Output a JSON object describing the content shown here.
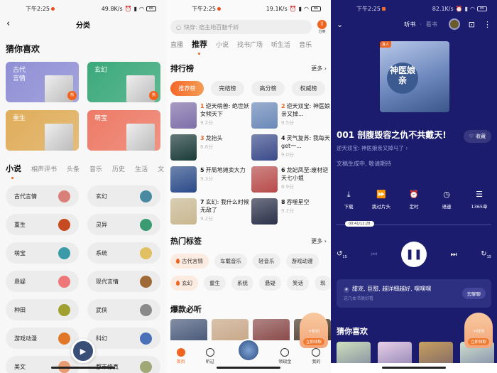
{
  "status_bars": [
    {
      "time": "下午2:25",
      "speed": "49.8K/s",
      "battery": "86"
    },
    {
      "time": "下午2:25",
      "speed": "19.1K/s",
      "battery": "86"
    },
    {
      "time": "下午2:25",
      "speed": "82.1K/s",
      "battery": "86"
    }
  ],
  "category_page": {
    "title": "分类",
    "guess_title": "猜你喜欢",
    "featured": [
      {
        "label": "古代\n言情",
        "hot": "热",
        "color": "#8f8fd6"
      },
      {
        "label": "玄幻",
        "hot": "热",
        "color": "#3aa97a"
      },
      {
        "label": "重生",
        "hot": "",
        "color": "#e0ad5a"
      },
      {
        "label": "萌宝",
        "hot": "",
        "color": "#ee7a66"
      }
    ],
    "tabs": [
      "小说",
      "相声评书",
      "头条",
      "音乐",
      "历史",
      "生活",
      "文"
    ],
    "active_tab": "小说",
    "categories": [
      {
        "label": "古代言情",
        "icon": "flower-icon",
        "color": "#d98078"
      },
      {
        "label": "玄幻",
        "icon": "mountain-icon",
        "color": "#4a8aa0"
      },
      {
        "label": "重生",
        "icon": "butterfly-icon",
        "color": "#c84a20"
      },
      {
        "label": "灵异",
        "icon": "sword-icon",
        "color": "#3a9a72"
      },
      {
        "label": "萌宝",
        "icon": "cloud-icon",
        "color": "#3a9aa8"
      },
      {
        "label": "系统",
        "icon": "screen-icon",
        "color": "#e0c060"
      },
      {
        "label": "悬疑",
        "icon": "crow-icon",
        "color": "#ee7878"
      },
      {
        "label": "现代言情",
        "icon": "bouquet-icon",
        "color": "#a06a38"
      },
      {
        "label": "种田",
        "icon": "wheat-icon",
        "color": "#a0a030"
      },
      {
        "label": "武侠",
        "icon": "crane-icon",
        "color": "#8a8a8a"
      },
      {
        "label": "游戏动漫",
        "icon": "gamepad-icon",
        "color": "#e07828"
      },
      {
        "label": "科幻",
        "icon": "planet-icon",
        "color": "#4a70b8"
      },
      {
        "label": "美文",
        "icon": "horse-icon",
        "color": "#e89a70"
      },
      {
        "label": "都市修真",
        "icon": "lotus-icon",
        "color": "#a0a878"
      }
    ]
  },
  "home_page": {
    "search_placeholder": "快穿: 宿主她百魅千娇",
    "category_button": "分类",
    "tabs": [
      "直播",
      "推荐",
      "小说",
      "找书广场",
      "听生活",
      "音乐"
    ],
    "active_tab": "推荐",
    "ranking": {
      "title": "排行榜",
      "more": "更多",
      "tabs": [
        "推荐榜",
        "完结榜",
        "高分榜",
        "权威榜"
      ],
      "items": [
        {
          "rank": "1",
          "title": "逆天萌兽: 绝世妖女倾天下",
          "score": "9.2分",
          "color": "#7e6ea8"
        },
        {
          "rank": "2",
          "title": "逆天双宝: 神医娘亲又掉...",
          "score": "9.5分",
          "color": "#6a88b8"
        },
        {
          "rank": "3",
          "title": "龙抬头",
          "score": "8.8分",
          "color": "#1a3a38"
        },
        {
          "rank": "4",
          "title": "灵气复苏: 我每天get一...",
          "score": "9.0分",
          "color": "#3a4a8a"
        },
        {
          "rank": "5",
          "title": "开局地摊卖大力",
          "score": "9.3分",
          "color": "#2a4a88"
        },
        {
          "rank": "6",
          "title": "龙妃凤至:废材逆天七小姐",
          "score": "8.9分",
          "color": "#b84a4a"
        },
        {
          "rank": "7",
          "title": "玄幻: 我什么时候无敌了",
          "score": "9.2分",
          "color": "#c8b890"
        },
        {
          "rank": "8",
          "title": "吞噬星空",
          "score": "9.2分",
          "color": "#2a3048"
        }
      ]
    },
    "hot_tags": {
      "title": "热门标签",
      "more": "更多",
      "row1": [
        {
          "label": "古代言情",
          "hot": true
        },
        {
          "label": "车载音乐",
          "hot": false
        },
        {
          "label": "轻音乐",
          "hot": false
        },
        {
          "label": "游戏动漫",
          "hot": false
        }
      ],
      "row2": [
        {
          "label": "玄幻",
          "hot": true
        },
        {
          "label": "重生",
          "hot": false
        },
        {
          "label": "系统",
          "hot": false
        },
        {
          "label": "悬疑",
          "hot": false
        },
        {
          "label": "笑话",
          "hot": false
        },
        {
          "label": "现",
          "hot": false
        }
      ]
    },
    "hits": {
      "title": "爆款必听",
      "covers": [
        "#4a5a7a",
        "#c8a888",
        "#8a4a4a",
        "#4a3a2a"
      ]
    },
    "reward": {
      "amount": "+600",
      "label": "立即领取"
    },
    "nav": [
      {
        "label": "首页",
        "icon": "home-icon",
        "active": true
      },
      {
        "label": "听过",
        "icon": "history-icon",
        "active": false
      },
      {
        "label": "",
        "icon": "now-playing-disc",
        "active": false
      },
      {
        "label": "领现金",
        "icon": "coin-icon",
        "active": false
      },
      {
        "label": "我的",
        "icon": "profile-icon",
        "active": false
      }
    ]
  },
  "player_page": {
    "mode_tabs": [
      "听书",
      "看书"
    ],
    "active_mode": "听书",
    "cover_badge": "真人",
    "cover_title": "神医娘亲",
    "chapter_title": "001 剖腹毁容之仇不共戴天!",
    "favorite_label": "收藏",
    "book_name": "逆天双宝: 神医娘亲又掉马了",
    "text_status": "文稿生成中, 敬请期待",
    "controls": [
      {
        "label": "下载",
        "icon": "download-icon",
        "glyph": "⤓"
      },
      {
        "label": "跳过片头",
        "icon": "skip-intro-icon",
        "glyph": "⏩"
      },
      {
        "label": "定时",
        "icon": "alarm-icon",
        "glyph": "⏰"
      },
      {
        "label": "语速",
        "icon": "speed-icon",
        "glyph": "◷"
      },
      {
        "label": "1365章",
        "icon": "chapter-list-icon",
        "glyph": "☰"
      }
    ],
    "time": "00:41/12:28",
    "progress": 0.055,
    "rewind_label": "15",
    "forward_label": "15",
    "chat": {
      "topic": "甜宠, 巨甜, 越详细越好, 嘿嘿嘿",
      "sub": "这几本书很好看",
      "button": "去聊聊"
    },
    "guess_title": "猜你喜欢",
    "guess_covers": [
      "#cfe0c0",
      "#e8d0e8",
      "#c8a060",
      "#d0e0d0"
    ],
    "reward": {
      "amount": "+600",
      "label": "立即领取"
    }
  }
}
